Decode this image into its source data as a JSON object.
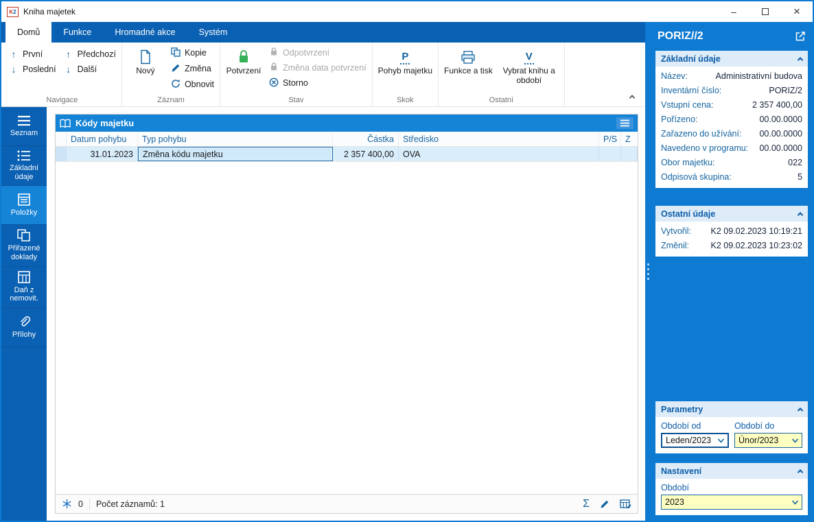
{
  "window": {
    "title": "Kniha majetek",
    "controls": {
      "minimize": "–",
      "close": "×"
    }
  },
  "icons": {
    "up_arrow": "↑",
    "down_arrow": "↓",
    "jump_letter": "P",
    "select_letter": "V",
    "sigma": "Σ",
    "flag_count": "0"
  },
  "tabs": [
    {
      "label": "Domů",
      "active": true
    },
    {
      "label": "Funkce",
      "active": false
    },
    {
      "label": "Hromadné akce",
      "active": false
    },
    {
      "label": "Systém",
      "active": false
    }
  ],
  "ribbon": {
    "nav": {
      "first": "První",
      "last": "Poslední",
      "prev": "Předchozí",
      "next": "Další",
      "group": "Navigace"
    },
    "record": {
      "new": "Nový",
      "copy": "Kopie",
      "change": "Změna",
      "refresh": "Obnovit",
      "group": "Záznam"
    },
    "state": {
      "confirm": "Potvrzení",
      "unconfirm": "Odpotvrzení",
      "change_date": "Změna data potvrzení",
      "cancel": "Storno",
      "group": "Stav"
    },
    "jump": {
      "asset_move": "Pohyb majetku",
      "group": "Skok"
    },
    "other": {
      "print": "Funkce a tisk",
      "select_book": "Vybrat knihu a období",
      "group": "Ostatní"
    }
  },
  "sidebar": {
    "items": [
      {
        "label": "Seznam"
      },
      {
        "label": "Základní údaje"
      },
      {
        "label": "Položky"
      },
      {
        "label": "Přiřazené doklady"
      },
      {
        "label": "Daň z nemovit."
      },
      {
        "label": "Přílohy"
      }
    ]
  },
  "grid": {
    "title": "Kódy majetku",
    "columns": [
      "Datum pohybu",
      "Typ pohybu",
      "Částka",
      "Středisko",
      "P/S",
      "Z"
    ],
    "rows": [
      {
        "date": "31.01.2023",
        "type": "Změna kódu majetku",
        "amount": "2 357 400,00",
        "center": "OVA",
        "ps": "",
        "z": ""
      }
    ],
    "status": {
      "flag_count": "0",
      "record_count": "Počet záznamů: 1"
    }
  },
  "right": {
    "title": "PORIZ//2",
    "basic": {
      "header": "Základní údaje",
      "rows": [
        {
          "label": "Název:",
          "value": "Administrativní budova"
        },
        {
          "label": "Inventární číslo:",
          "value": "PORIZ/2"
        },
        {
          "label": "Vstupní cena:",
          "value": "2 357 400,00"
        },
        {
          "label": "Pořízeno:",
          "value": "00.00.0000"
        },
        {
          "label": "Zařazeno do užívání:",
          "value": "00.00.0000"
        },
        {
          "label": "Navedeno v programu:",
          "value": "00.00.0000"
        },
        {
          "label": "Obor majetku:",
          "value": "022"
        },
        {
          "label": "Odpisová skupina:",
          "value": "5"
        }
      ]
    },
    "other": {
      "header": "Ostatní údaje",
      "rows": [
        {
          "label": "Vytvořil:",
          "value": "K2 09.02.2023 10:19:21"
        },
        {
          "label": "Změnil:",
          "value": "K2 09.02.2023 10:23:02"
        }
      ]
    },
    "params": {
      "header": "Parametry",
      "from_label": "Období od",
      "to_label": "Období do",
      "from_value": "Leden/2023",
      "to_value": "Únor/2023"
    },
    "settings": {
      "header": "Nastavení",
      "period_label": "Období",
      "period_value": "2023"
    }
  }
}
